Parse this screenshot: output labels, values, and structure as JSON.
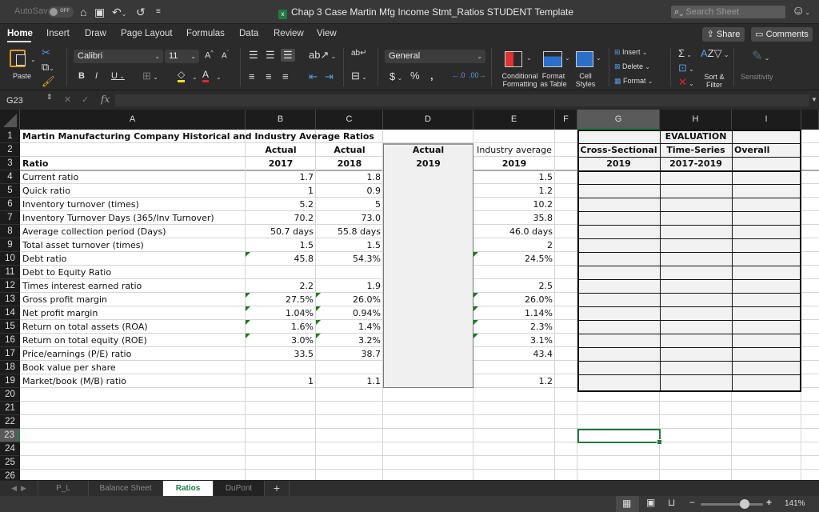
{
  "titlebar": {
    "autosave_label": "AutoSave",
    "autosave_state": "OFF",
    "doc_title": "Chap 3 Case Martin Mfg Income Stmt_Ratios STUDENT Template",
    "search_placeholder": "Search Sheet"
  },
  "ribbon": {
    "tabs": [
      "Home",
      "Insert",
      "Draw",
      "Page Layout",
      "Formulas",
      "Data",
      "Review",
      "View"
    ],
    "active_tab": "Home",
    "share_label": "Share",
    "comments_label": "Comments",
    "paste_label": "Paste",
    "font_name": "Calibri",
    "font_size": "11",
    "number_format": "General",
    "conditional_formatting": "Conditional Formatting",
    "format_as_table": "Format as Table",
    "cell_styles": "Cell Styles",
    "insert_label": "Insert",
    "delete_label": "Delete",
    "format_label": "Format",
    "sort_filter": "Sort & Filter",
    "sensitivity": "Sensitivity"
  },
  "formula_bar": {
    "name_box": "G23",
    "fx": "fx",
    "value": ""
  },
  "columns": [
    "A",
    "B",
    "C",
    "D",
    "E",
    "F",
    "G",
    "H",
    "I"
  ],
  "selected_column": "G",
  "selected_row": 23,
  "rows": [
    1,
    2,
    3,
    4,
    5,
    6,
    7,
    8,
    9,
    10,
    11,
    12,
    13,
    14,
    15,
    16,
    17,
    18,
    19,
    20,
    21,
    22,
    23,
    24,
    25,
    26
  ],
  "sheet": {
    "title": "Martin Manufacturing Company Historical and Industry Average Ratios",
    "header_row2": {
      "B": "Actual",
      "C": "Actual",
      "D": "Actual",
      "E": "Industry average"
    },
    "header_row3": {
      "A": "Ratio",
      "B": "2017",
      "C": "2018",
      "D": "2019",
      "E": "2019"
    },
    "evaluation": {
      "title": "EVALUATION",
      "G2": "Cross-Sectional",
      "H2": "Time-Series",
      "I2": "Overall",
      "G3": "2019",
      "H3": "2017-2019"
    },
    "ratios": [
      {
        "name": "Current ratio",
        "y2017": "1.7",
        "y2018": "1.8",
        "industry": "1.5"
      },
      {
        "name": "Quick ratio",
        "y2017": "1",
        "y2018": "0.9",
        "industry": "1.2"
      },
      {
        "name": "Inventory turnover (times)",
        "y2017": "5.2",
        "y2018": "5",
        "industry": "10.2"
      },
      {
        "name": "Inventory Turnover Days (365/Inv Turnover)",
        "y2017": "70.2",
        "y2018": "73.0",
        "industry": "35.8"
      },
      {
        "name": "Average collection period (Days)",
        "y2017": "50.7 days",
        "y2018": "55.8 days",
        "industry": "46.0 days"
      },
      {
        "name": "Total asset turnover (times)",
        "y2017": "1.5",
        "y2018": "1.5",
        "industry": "2"
      },
      {
        "name": "Debt ratio",
        "y2017": "45.8",
        "y2018": "54.3%",
        "industry": "24.5%"
      },
      {
        "name": "Debt to Equity Ratio",
        "y2017": "",
        "y2018": "",
        "industry": ""
      },
      {
        "name": "Times interest earned ratio",
        "y2017": "2.2",
        "y2018": "1.9",
        "industry": "2.5"
      },
      {
        "name": "Gross profit margin",
        "y2017": "27.5%",
        "y2018": "26.0%",
        "industry": "26.0%"
      },
      {
        "name": "Net profit margin",
        "y2017": "1.04%",
        "y2018": "0.94%",
        "industry": "1.14%"
      },
      {
        "name": "Return on total assets (ROA)",
        "y2017": "1.6%",
        "y2018": "1.4%",
        "industry": "2.3%"
      },
      {
        "name": "Return on total equity (ROE)",
        "y2017": "3.0%",
        "y2018": "3.2%",
        "industry": "3.1%"
      },
      {
        "name": "Price/earnings (P/E) ratio",
        "y2017": "33.5",
        "y2018": "38.7",
        "industry": "43.4"
      },
      {
        "name": "Book value per share",
        "y2017": "",
        "y2018": "",
        "industry": ""
      },
      {
        "name": "Market/book (M/B) ratio",
        "y2017": "1",
        "y2018": "1.1",
        "industry": "1.2"
      }
    ]
  },
  "sheet_tabs": [
    "P_L",
    "Balance Sheet",
    "Ratios",
    "DuPont"
  ],
  "active_sheet": "Ratios",
  "add_sheet": "+",
  "status": {
    "zoom": "141%",
    "zoom_fraction": 0.7
  },
  "colors": {
    "accent_green": "#1f7a44",
    "error_triangle": "#1e7a1e"
  }
}
